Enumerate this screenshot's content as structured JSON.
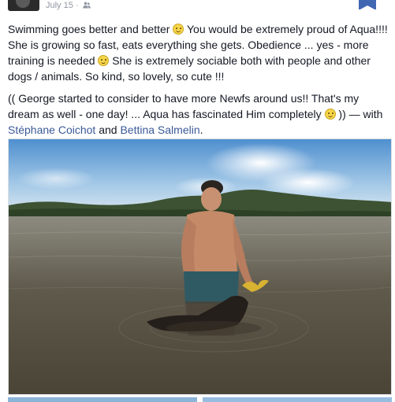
{
  "post": {
    "date": "July 15",
    "separator": "·",
    "audience_icon": "friends-icon",
    "paragraph1_a": "Swimming goes better and better ",
    "paragraph1_b": " You would be extremely proud of Aqua!!!! She is growing so fast, eats everything she gets. Obedience ... yes - more training is needed ",
    "paragraph1_c": " She is extremely sociable both with people and other dogs / animals. So kind, so lovely, so cute !!!",
    "paragraph2_a": "(( George started to consider to have more Newfs around us!! That's my dream as well - one day! ... Aqua has fascinated Him completely ",
    "paragraph2_b": " )) — with ",
    "tag1": "Stéphane Coichot",
    "and_word": " and ",
    "tag2": "Bettina Salmelin",
    "period": "."
  },
  "colors": {
    "link": "#3b5998",
    "meta": "#9197a3",
    "bookmark": "#4267b2"
  }
}
